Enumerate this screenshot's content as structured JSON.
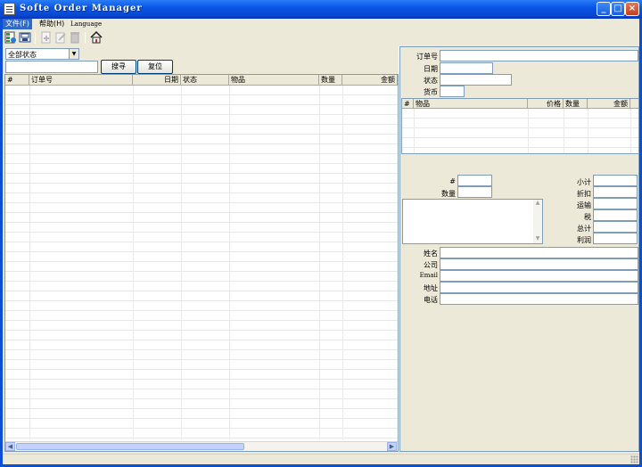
{
  "window": {
    "title": "Softe Order Manager",
    "controls": {
      "minimize": "_",
      "maximize": "□",
      "close": "×"
    }
  },
  "menu": {
    "file": "文件(F)",
    "help": "帮助(H)",
    "language": "Language"
  },
  "toolbar": {
    "icons": [
      "database-icon",
      "save-icon",
      "new-order-icon",
      "edit-icon",
      "delete-icon",
      "home-icon"
    ]
  },
  "filter": {
    "status_selected": "全部状态",
    "search_value": "",
    "search_button": "搜寻",
    "reset_button": "复位"
  },
  "order_list": {
    "columns": [
      "#",
      "订单号",
      "日期",
      "状态",
      "物品",
      "数量",
      "金额"
    ],
    "rows": []
  },
  "detail": {
    "order_no_label": "订单号",
    "date_label": "日期",
    "status_label": "状态",
    "currency_label": "货币",
    "items_columns": [
      "#",
      "物品",
      "价格",
      "数量",
      "金额"
    ],
    "item_no_label": "#",
    "quantity_label": "数量",
    "subtotal_label": "小计",
    "discount_label": "折扣",
    "shipping_label": "运输",
    "tax_label": "税",
    "total_label": "总计",
    "profit_label": "利润",
    "name_label": "姓名",
    "company_label": "公司",
    "email_label": "Email",
    "address_label": "地址",
    "phone_label": "电话"
  }
}
